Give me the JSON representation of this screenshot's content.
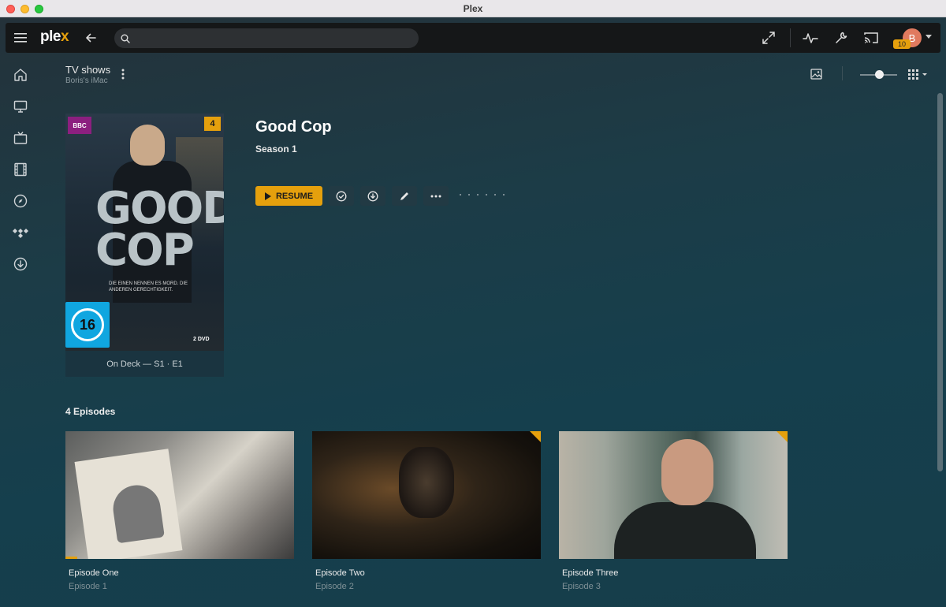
{
  "window": {
    "title": "Plex"
  },
  "topbar": {
    "logo_text": "ple",
    "logo_accent": "x",
    "search": {
      "value": "",
      "placeholder": ""
    },
    "profile": {
      "initial": "B",
      "badge": "10"
    }
  },
  "sidebar": {
    "items": [
      {
        "name": "home",
        "icon": "home-icon"
      },
      {
        "name": "tv",
        "icon": "monitor-icon"
      },
      {
        "name": "live-tv",
        "icon": "tv-icon"
      },
      {
        "name": "movies",
        "icon": "film-icon"
      },
      {
        "name": "discover",
        "icon": "compass-icon"
      },
      {
        "name": "tidal",
        "icon": "tidal-icon"
      },
      {
        "name": "downloads",
        "icon": "download-icon"
      }
    ]
  },
  "library": {
    "title": "TV shows",
    "server": "Boris's iMac"
  },
  "show": {
    "title": "Good Cop",
    "season": "Season 1",
    "episode_count_badge": "4",
    "poster": {
      "network": "BBC",
      "title_line1": "GOOD",
      "title_line2": "COP",
      "tagline": "DIE EINEN NENNEN ES MORD. DIE ANDEREN GERECHTIGKEIT.",
      "rating": "16",
      "rating_label": "FSK",
      "format": "2 DVD"
    },
    "on_deck": "On Deck — S1 · E1"
  },
  "actions": {
    "resume_label": "RESUME"
  },
  "episodes": {
    "heading": "4 Episodes",
    "items": [
      {
        "title": "Episode One",
        "subtitle": "Episode 1",
        "unwatched": false,
        "progress": 0.05
      },
      {
        "title": "Episode Two",
        "subtitle": "Episode 2",
        "unwatched": true,
        "progress": 0
      },
      {
        "title": "Episode Three",
        "subtitle": "Episode 3",
        "unwatched": true,
        "progress": 0
      }
    ]
  },
  "colors": {
    "accent": "#e5a00d",
    "topbar": "#151718",
    "background": "#163d4a"
  }
}
